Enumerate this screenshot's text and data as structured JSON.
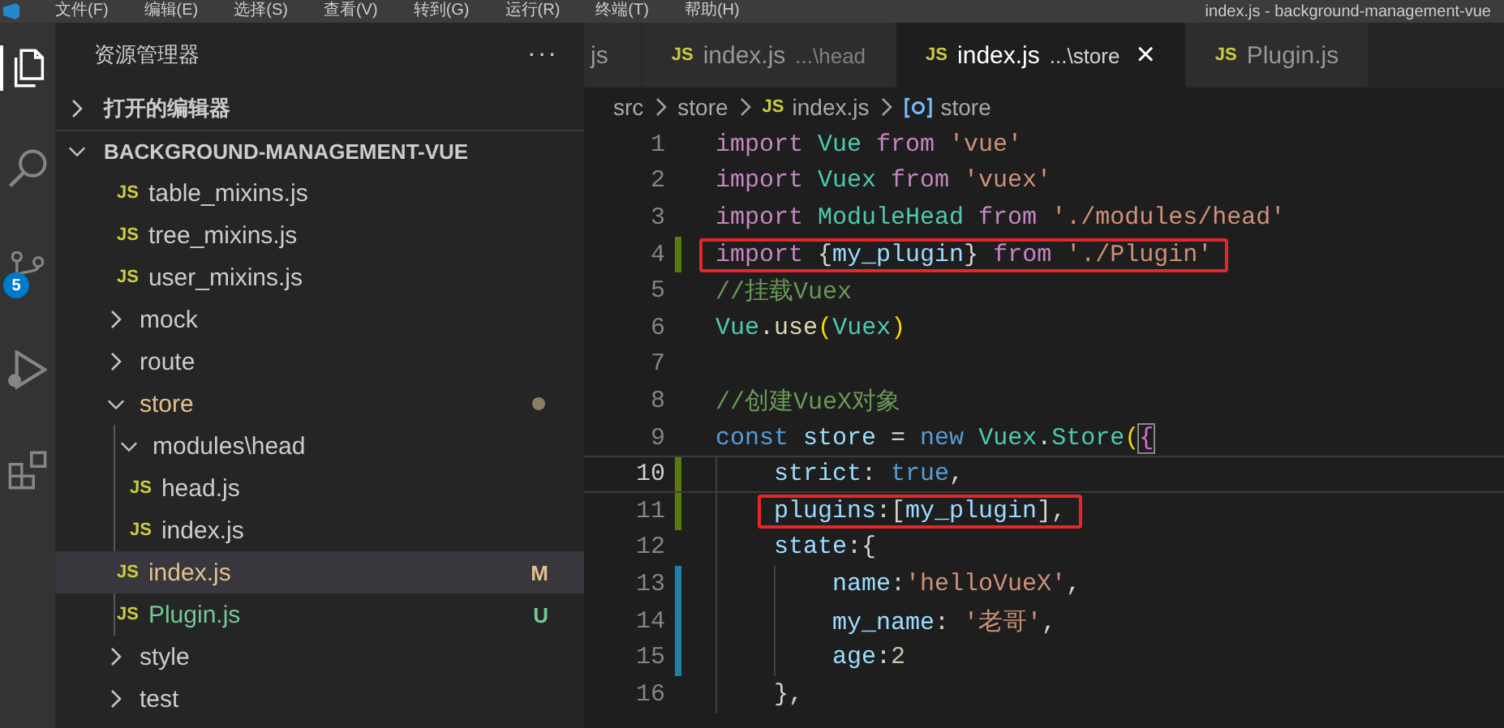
{
  "menu_bar": {
    "items": [
      "文件(F)",
      "编辑(E)",
      "选择(S)",
      "查看(V)",
      "转到(G)",
      "运行(R)",
      "终端(T)",
      "帮助(H)"
    ],
    "title": "index.js - background-management-vue"
  },
  "activity_bar": [
    {
      "kind": "files",
      "selected": true
    },
    {
      "kind": "search",
      "selected": false
    },
    {
      "kind": "source-control",
      "selected": false,
      "badge": "5"
    },
    {
      "kind": "run",
      "selected": false
    },
    {
      "kind": "extensions",
      "selected": false
    }
  ],
  "explorer": {
    "title": "资源管理器",
    "more": "···",
    "sections": [
      {
        "label": "打开的编辑器",
        "expanded": false
      },
      {
        "label": "BACKGROUND-MANAGEMENT-VUE",
        "expanded": true
      }
    ],
    "tree": [
      {
        "kind": "group",
        "children": [
          {
            "kind": "file",
            "icon": "JS",
            "name": "table_mixins.js",
            "selected": false
          },
          {
            "kind": "file",
            "icon": "JS",
            "name": "tree_mixins.js",
            "selected": false
          },
          {
            "kind": "file",
            "icon": "JS",
            "name": "user_mixins.js",
            "selected": false
          }
        ]
      },
      {
        "kind": "folder",
        "name": "mock",
        "expanded": false,
        "selected": false
      },
      {
        "kind": "folder",
        "name": "route",
        "expanded": false,
        "selected": false
      },
      {
        "kind": "folder",
        "name": "store",
        "expanded": true,
        "selected": false,
        "color": "#e2c08d",
        "modified_dot": true,
        "children": [
          {
            "kind": "folder",
            "name": "modules\\head",
            "expanded": true,
            "selected": false,
            "children": [
              {
                "kind": "file",
                "icon": "JS",
                "name": "head.js",
                "selected": false
              },
              {
                "kind": "file",
                "icon": "JS",
                "name": "index.js",
                "selected": false
              }
            ]
          },
          {
            "kind": "file",
            "icon": "JS",
            "name": "index.js",
            "selected": true,
            "color": "#e2c08d",
            "badge": "M"
          },
          {
            "kind": "file",
            "icon": "JS",
            "name": "Plugin.js",
            "selected": false,
            "color": "#73c991",
            "badge": "U"
          }
        ]
      },
      {
        "kind": "folder",
        "name": "style",
        "expanded": false,
        "selected": false
      },
      {
        "kind": "folder",
        "name": "test",
        "expanded": false,
        "selected": false
      }
    ]
  },
  "tabs": [
    {
      "label": "js",
      "selected": false
    },
    {
      "icon": "JS",
      "label": "index.js",
      "description": "...\\head",
      "selected": false
    },
    {
      "icon": "JS",
      "label": "index.js",
      "description": "...\\store",
      "selected": true,
      "close": "×"
    },
    {
      "icon": "JS",
      "label": "Plugin.js",
      "selected": false
    }
  ],
  "breadcrumb": [
    {
      "kind": "folder",
      "label": "src"
    },
    {
      "kind": "folder",
      "label": "store"
    },
    {
      "kind": "file",
      "icon": "JS",
      "label": "index.js"
    },
    {
      "kind": "symbol",
      "label": "store"
    }
  ],
  "code": {
    "lines": [
      {
        "number": "1",
        "added": false,
        "modified": false,
        "current": false,
        "highlighted": false,
        "tokens": [
          {
            "kind": "keyword",
            "text": "import "
          },
          {
            "kind": "type",
            "text": "Vue "
          },
          {
            "kind": "keyword",
            "text": "from "
          },
          {
            "kind": "string",
            "text": "'vue'"
          }
        ]
      },
      {
        "number": "2",
        "added": false,
        "modified": false,
        "current": false,
        "highlighted": false,
        "tokens": [
          {
            "kind": "keyword",
            "text": "import "
          },
          {
            "kind": "type",
            "text": "Vuex "
          },
          {
            "kind": "keyword",
            "text": "from "
          },
          {
            "kind": "string",
            "text": "'vuex'"
          }
        ]
      },
      {
        "number": "3",
        "added": false,
        "modified": false,
        "current": false,
        "highlighted": false,
        "tokens": [
          {
            "kind": "keyword",
            "text": "import "
          },
          {
            "kind": "type",
            "text": "ModuleHead "
          },
          {
            "kind": "keyword",
            "text": "from "
          },
          {
            "kind": "string",
            "text": "'./modules/head'"
          }
        ]
      },
      {
        "number": "4",
        "added": true,
        "modified": false,
        "current": false,
        "highlighted": true,
        "tokens": [
          {
            "kind": "keyword",
            "text": "import "
          },
          {
            "kind": "plain",
            "text": "{"
          },
          {
            "kind": "variable",
            "text": "my_plugin"
          },
          {
            "kind": "plain",
            "text": "} "
          },
          {
            "kind": "keyword",
            "text": "from "
          },
          {
            "kind": "string",
            "text": "'./Plugin'"
          }
        ]
      },
      {
        "number": "5",
        "added": false,
        "modified": false,
        "current": false,
        "highlighted": false,
        "tokens": [
          {
            "kind": "comment",
            "text": "//挂载Vuex"
          }
        ]
      },
      {
        "number": "6",
        "added": false,
        "modified": false,
        "current": false,
        "highlighted": false,
        "tokens": [
          {
            "kind": "type",
            "text": "Vue"
          },
          {
            "kind": "plain",
            "text": "."
          },
          {
            "kind": "function",
            "text": "use"
          },
          {
            "kind": "bracket",
            "text": "("
          },
          {
            "kind": "type",
            "text": "Vuex"
          },
          {
            "kind": "bracket",
            "text": ")"
          }
        ]
      },
      {
        "number": "7",
        "added": false,
        "modified": false,
        "current": false,
        "highlighted": false
      },
      {
        "number": "8",
        "added": false,
        "modified": false,
        "current": false,
        "highlighted": false,
        "tokens": [
          {
            "kind": "comment",
            "text": "//创建VueX对象"
          }
        ]
      },
      {
        "number": "9",
        "added": false,
        "modified": false,
        "current": false,
        "highlighted": false,
        "tokens": [
          {
            "kind": "storage",
            "text": "const "
          },
          {
            "kind": "variable",
            "text": "store"
          },
          {
            "kind": "plain",
            "text": " = "
          },
          {
            "kind": "storage",
            "text": "new "
          },
          {
            "kind": "type",
            "text": "Vuex"
          },
          {
            "kind": "plain",
            "text": "."
          },
          {
            "kind": "type",
            "text": "Store"
          },
          {
            "kind": "bracket",
            "text": "("
          },
          {
            "kind": "matched",
            "text": "{"
          }
        ]
      },
      {
        "number": "10",
        "added": true,
        "modified": false,
        "current": true,
        "highlighted": false,
        "tokens": [
          {
            "kind": "property",
            "text": "    strict"
          },
          {
            "kind": "plain",
            "text": ": "
          },
          {
            "kind": "storage",
            "text": "true"
          },
          {
            "kind": "plain",
            "text": ","
          }
        ]
      },
      {
        "number": "11",
        "added": true,
        "modified": false,
        "current": false,
        "highlighted": true,
        "tokens": [
          {
            "kind": "property",
            "text": "    plugins"
          },
          {
            "kind": "plain",
            "text": ":["
          },
          {
            "kind": "variable",
            "text": "my_plugin"
          },
          {
            "kind": "plain",
            "text": "],"
          }
        ]
      },
      {
        "number": "12",
        "added": false,
        "modified": false,
        "current": false,
        "highlighted": false,
        "tokens": [
          {
            "kind": "property",
            "text": "    state"
          },
          {
            "kind": "plain",
            "text": ":{"
          }
        ]
      },
      {
        "number": "13",
        "added": false,
        "modified": true,
        "current": false,
        "highlighted": false,
        "tokens": [
          {
            "kind": "property",
            "text": "        name"
          },
          {
            "kind": "plain",
            "text": ":"
          },
          {
            "kind": "string",
            "text": "'helloVueX'"
          },
          {
            "kind": "plain",
            "text": ","
          }
        ]
      },
      {
        "number": "14",
        "added": false,
        "modified": true,
        "current": false,
        "highlighted": false,
        "tokens": [
          {
            "kind": "property",
            "text": "        my_name"
          },
          {
            "kind": "plain",
            "text": ": "
          },
          {
            "kind": "string",
            "text": "'老哥'"
          },
          {
            "kind": "plain",
            "text": ","
          }
        ]
      },
      {
        "number": "15",
        "added": false,
        "modified": true,
        "current": false,
        "highlighted": false,
        "tokens": [
          {
            "kind": "property",
            "text": "        age"
          },
          {
            "kind": "plain",
            "text": ":"
          },
          {
            "kind": "number",
            "text": "2"
          }
        ]
      },
      {
        "number": "16",
        "added": false,
        "modified": false,
        "current": false,
        "highlighted": false,
        "tokens": [
          {
            "kind": "plain",
            "text": "    },"
          }
        ]
      }
    ]
  }
}
